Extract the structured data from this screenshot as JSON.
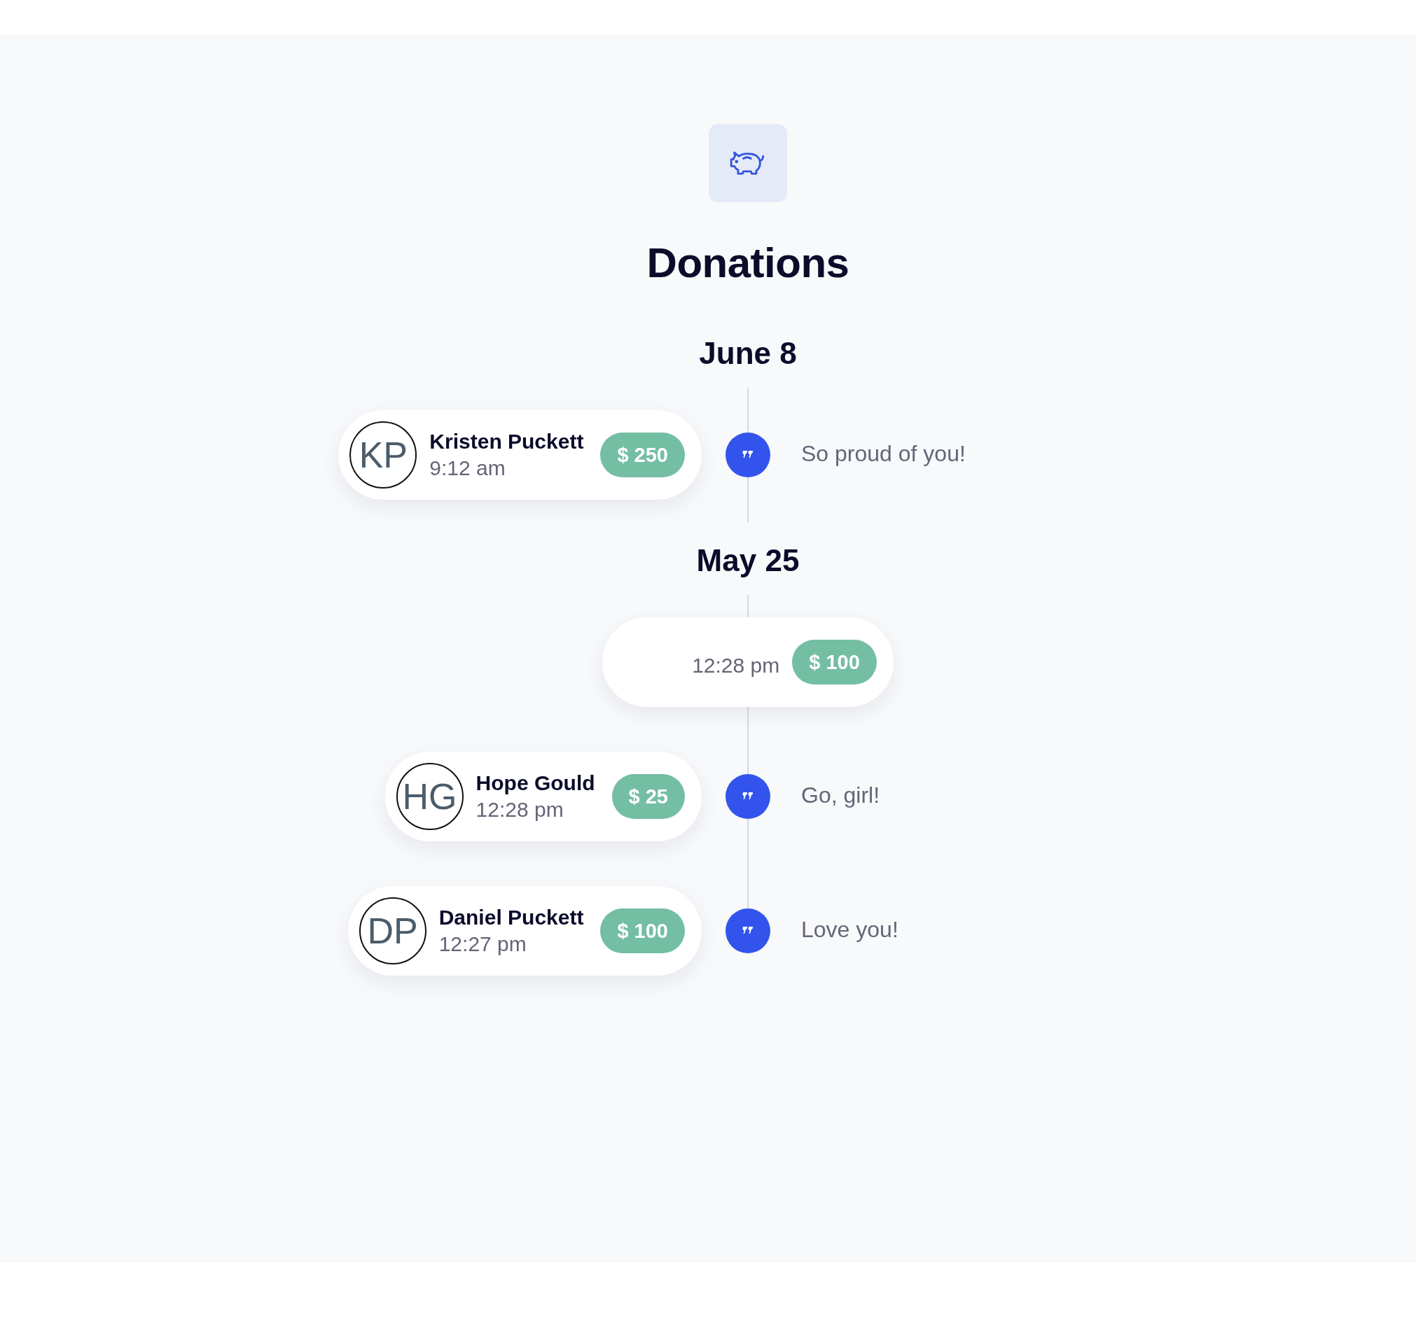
{
  "header": {
    "title": "Donations"
  },
  "groups": [
    {
      "date": "June 8",
      "donations": [
        {
          "kind": "named",
          "initials": "KP",
          "name": "Kristen Puckett",
          "time": "9:12 am",
          "amount": "$ 250",
          "message": "So proud of you!"
        }
      ]
    },
    {
      "date": "May 25",
      "donations": [
        {
          "kind": "anonymous",
          "time": "12:28 pm",
          "amount": "$ 100"
        },
        {
          "kind": "named",
          "initials": "HG",
          "name": "Hope Gould",
          "time": "12:28 pm",
          "amount": "$ 25",
          "message": "Go, girl!"
        },
        {
          "kind": "named",
          "initials": "DP",
          "name": "Daniel Puckett",
          "time": "12:27 pm",
          "amount": "$ 100",
          "message": "Love you!"
        }
      ]
    }
  ]
}
